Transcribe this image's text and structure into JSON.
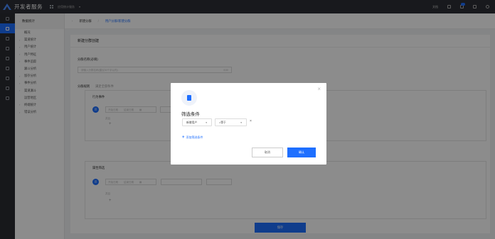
{
  "app": {
    "title": "开发者服务",
    "app_select": "应用统计服务",
    "top_right": {
      "docs": "文档"
    }
  },
  "menu": {
    "header": "数据统计",
    "items": [
      {
        "label": "概况",
        "type": "plain"
      },
      {
        "label": "渠道统计",
        "type": "group"
      },
      {
        "label": "用户统计",
        "type": "group"
      },
      {
        "label": "用户特征",
        "type": "group"
      },
      {
        "label": "事件追踪",
        "type": "group"
      },
      {
        "label": "漏斗分析",
        "type": "plain"
      },
      {
        "label": "留存分析",
        "type": "group"
      },
      {
        "label": "事件分析",
        "type": "group"
      },
      {
        "label": "渠道漏斗",
        "type": "group"
      },
      {
        "label": "运营地区",
        "type": "plain"
      },
      {
        "label": "终端统计",
        "type": "group"
      },
      {
        "label": "错误分析",
        "type": "group"
      }
    ]
  },
  "breadcrumb": {
    "parent": "新建分群",
    "current": "用户分群/新建分群"
  },
  "form": {
    "card_title": "新建分群创建",
    "name_label": "分群名称(必填)",
    "name_placeholder": "请输入分群名称(建议30个字以内)",
    "name_counter": "0/30",
    "rule_label": "分群规则",
    "rule_hint": "满足全部条件",
    "section1_title": "行为事件",
    "section2_title": "属性筛选",
    "circle_label": "且",
    "date_start": "开始日期",
    "date_end": "结束日期",
    "and_text": "并且",
    "submit": "保存"
  },
  "modal": {
    "title": "筛选条件",
    "field_value": "新增用户",
    "operator_value": "=等于",
    "add_condition": "添加筛选条件",
    "cancel": "取消",
    "ok": "确认"
  }
}
